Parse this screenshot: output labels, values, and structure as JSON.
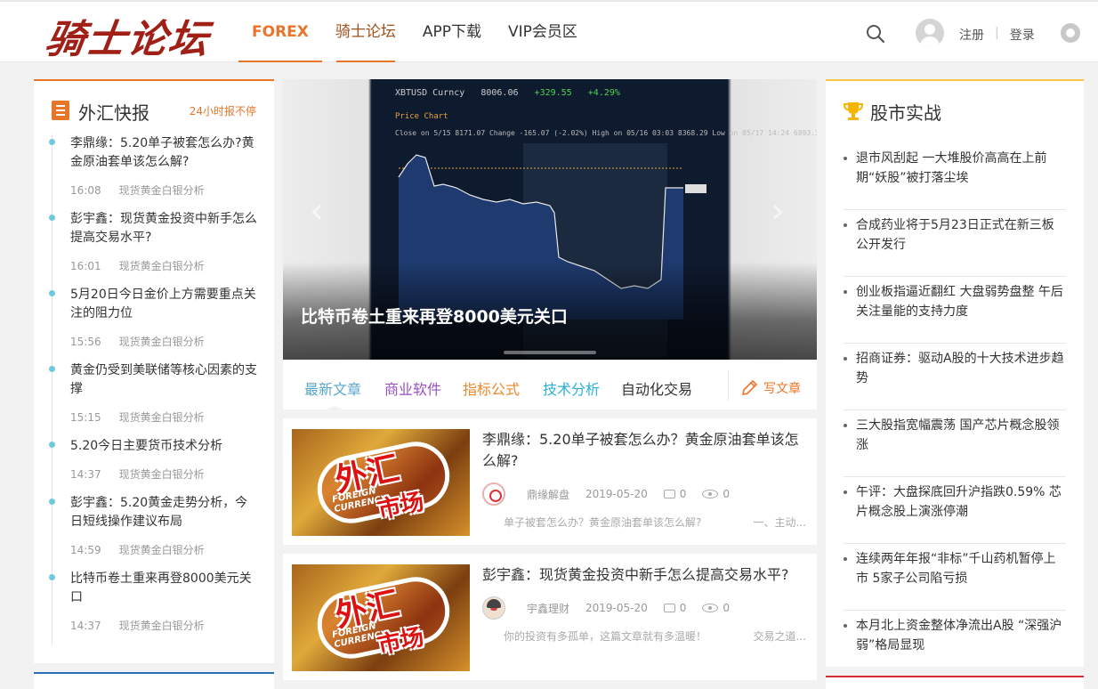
{
  "header": {
    "logo": "骑士论坛",
    "nav": [
      {
        "label": "FOREX"
      },
      {
        "label": "骑士论坛"
      },
      {
        "label": "APP下载"
      },
      {
        "label": "VIP会员区"
      }
    ],
    "register": "注册",
    "separator": "|",
    "login": "登录"
  },
  "flash": {
    "title": "外汇快报",
    "subtitle": "24小时报不停",
    "items": [
      {
        "title": "李鼎缘：5.20单子被套怎么办?黄金原油套单该怎么解?",
        "time": "16:08",
        "category": "现货黄金白银分析"
      },
      {
        "title": "彭宇鑫：现货黄金投资中新手怎么提高交易水平?",
        "time": "16:01",
        "category": "现货黄金白银分析"
      },
      {
        "title": "5月20日今日金价上方需要重点关注的阻力位",
        "time": "15:56",
        "category": "现货黄金白银分析"
      },
      {
        "title": "黄金仍受到美联储等核心因素的支撑",
        "time": "15:15",
        "category": "现货黄金白银分析"
      },
      {
        "title": "5.20今日主要货币技术分析",
        "time": "14:37",
        "category": "现货黄金白银分析"
      },
      {
        "title": "彭宇鑫：5.20黄金走势分析，今日短线操作建议布局",
        "time": "14:59",
        "category": "现货黄金白银分析"
      },
      {
        "title": "比特币卷土重来再登8000美元关口",
        "time": "14:37",
        "category": "现货黄金白银分析"
      }
    ]
  },
  "slider": {
    "caption": "比特币卷土重来再登8000美元关口",
    "chart_head": "XBTUSD Curncy",
    "chart_price": "8006.06",
    "chart_change": "+329.55",
    "chart_pct": "+4.29%",
    "chart_sub": "Price Chart",
    "chart_legend": "Close on 5/15 8171.07   Change -165.07 (-2.02%)   High on 05/16 03:03 8368.29   Low on 05/17 14:24 6893.32"
  },
  "tabs": {
    "items": [
      "最新文章",
      "商业软件",
      "指标公式",
      "技术分析",
      "自动化交易"
    ],
    "write": "写文章"
  },
  "articles": [
    {
      "title": "李鼎缘：5.20单子被套怎么办？黄金原油套单该怎么解?",
      "author": "鼎缘解盘",
      "date": "2019-05-20",
      "comments": "0",
      "views": "0",
      "excerpt": "单子被套怎么办？黄金原油套单该怎么解?",
      "excerpt_right": "一、主动..."
    },
    {
      "title": "彭宇鑫：现货黄金投资中新手怎么提高交易水平?",
      "author": "宇鑫理财",
      "date": "2019-05-20",
      "comments": "0",
      "views": "0",
      "excerpt": "你的投资有多孤单，这篇文章就有多温暖！",
      "excerpt_right": "交易之道..."
    }
  ],
  "thumb": {
    "w1": "外汇",
    "w2": "市场",
    "w3a": "FOREIGN",
    "w3b": "CURRENCY"
  },
  "stock": {
    "title": "股市实战",
    "items": [
      "退市风刮起 一大堆股价高高在上前期“妖股”被打落尘埃",
      "合成药业将于5月23日正式在新三板公开发行",
      "创业板指逼近翻红 大盘弱势盘整 午后关注量能的支持力度",
      "招商证券：驱动A股的十大技术进步趋势",
      "三大股指宽幅震荡 国产芯片概念股领涨",
      "午评：大盘探底回升沪指跌0.59% 芯片概念股上演涨停潮",
      "连续两年年报“非标”千山药机暂停上市 5家子公司陷亏损",
      "本月北上资金整体净流出A股 “深强沪弱”格局显现"
    ]
  },
  "colors": {
    "accent": "#e8752a",
    "stock_accent": "#f5c842",
    "link_blue": "#5aa8c8"
  }
}
